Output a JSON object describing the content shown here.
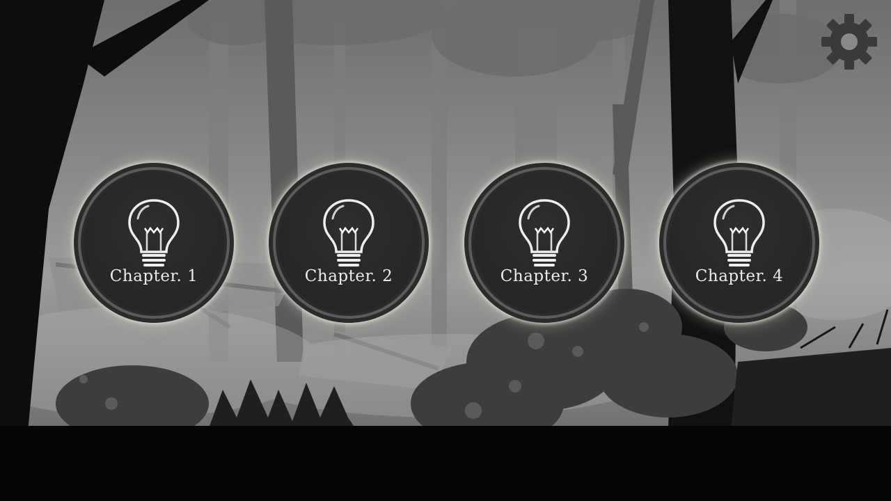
{
  "chapters": [
    {
      "label": "Chapter. 1",
      "icon": "lightbulb-icon"
    },
    {
      "label": "Chapter. 2",
      "icon": "lightbulb-icon"
    },
    {
      "label": "Chapter. 3",
      "icon": "lightbulb-icon"
    },
    {
      "label": "Chapter. 4",
      "icon": "lightbulb-icon"
    }
  ],
  "settings": {
    "icon": "gear-icon"
  },
  "colors": {
    "button_fill": "#2b2b2b",
    "button_ring": "#5b5b5b",
    "button_glow": "#e1e1d2",
    "label_text": "#ececec",
    "silhouette": "#0d0d0d",
    "gear": "#3a3a3a"
  }
}
